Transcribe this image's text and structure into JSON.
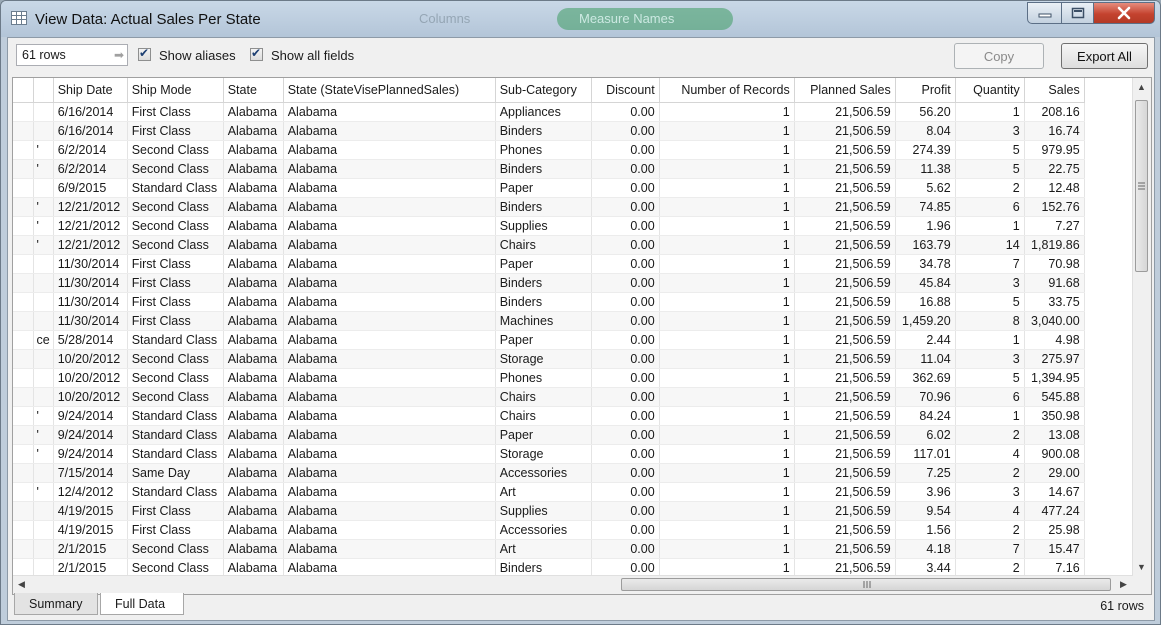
{
  "window": {
    "title": "View Data:  Actual Sales Per State",
    "ghost_columns": "Columns",
    "ghost_search": "Measure Names"
  },
  "toolbar": {
    "rows_value": "61 rows",
    "show_aliases_label": "Show aliases",
    "show_all_fields_label": "Show all fields",
    "copy_label": "Copy",
    "export_label": "Export All"
  },
  "table": {
    "columns": [
      "",
      "Ship Date",
      "Ship Mode",
      "State",
      "State (StateVisePlannedSales)",
      "Sub-Category",
      "Discount",
      "Number of Records",
      "Planned Sales",
      "Profit",
      "Quantity",
      "Sales"
    ],
    "rows": [
      [
        "",
        "6/16/2014",
        "First Class",
        "Alabama",
        "Alabama",
        "Appliances",
        "0.00",
        "1",
        "21,506.59",
        "56.20",
        "1",
        "208.16"
      ],
      [
        "",
        "6/16/2014",
        "First Class",
        "Alabama",
        "Alabama",
        "Binders",
        "0.00",
        "1",
        "21,506.59",
        "8.04",
        "3",
        "16.74"
      ],
      [
        "'",
        "6/2/2014",
        "Second Class",
        "Alabama",
        "Alabama",
        "Phones",
        "0.00",
        "1",
        "21,506.59",
        "274.39",
        "5",
        "979.95"
      ],
      [
        "'",
        "6/2/2014",
        "Second Class",
        "Alabama",
        "Alabama",
        "Binders",
        "0.00",
        "1",
        "21,506.59",
        "11.38",
        "5",
        "22.75"
      ],
      [
        "",
        "6/9/2015",
        "Standard Class",
        "Alabama",
        "Alabama",
        "Paper",
        "0.00",
        "1",
        "21,506.59",
        "5.62",
        "2",
        "12.48"
      ],
      [
        "'",
        "12/21/2012",
        "Second Class",
        "Alabama",
        "Alabama",
        "Binders",
        "0.00",
        "1",
        "21,506.59",
        "74.85",
        "6",
        "152.76"
      ],
      [
        "'",
        "12/21/2012",
        "Second Class",
        "Alabama",
        "Alabama",
        "Supplies",
        "0.00",
        "1",
        "21,506.59",
        "1.96",
        "1",
        "7.27"
      ],
      [
        "'",
        "12/21/2012",
        "Second Class",
        "Alabama",
        "Alabama",
        "Chairs",
        "0.00",
        "1",
        "21,506.59",
        "163.79",
        "14",
        "1,819.86"
      ],
      [
        "",
        "11/30/2014",
        "First Class",
        "Alabama",
        "Alabama",
        "Paper",
        "0.00",
        "1",
        "21,506.59",
        "34.78",
        "7",
        "70.98"
      ],
      [
        "",
        "11/30/2014",
        "First Class",
        "Alabama",
        "Alabama",
        "Binders",
        "0.00",
        "1",
        "21,506.59",
        "45.84",
        "3",
        "91.68"
      ],
      [
        "",
        "11/30/2014",
        "First Class",
        "Alabama",
        "Alabama",
        "Binders",
        "0.00",
        "1",
        "21,506.59",
        "16.88",
        "5",
        "33.75"
      ],
      [
        "",
        "11/30/2014",
        "First Class",
        "Alabama",
        "Alabama",
        "Machines",
        "0.00",
        "1",
        "21,506.59",
        "1,459.20",
        "8",
        "3,040.00"
      ],
      [
        "ce",
        "5/28/2014",
        "Standard Class",
        "Alabama",
        "Alabama",
        "Paper",
        "0.00",
        "1",
        "21,506.59",
        "2.44",
        "1",
        "4.98"
      ],
      [
        "",
        "10/20/2012",
        "Second Class",
        "Alabama",
        "Alabama",
        "Storage",
        "0.00",
        "1",
        "21,506.59",
        "11.04",
        "3",
        "275.97"
      ],
      [
        "",
        "10/20/2012",
        "Second Class",
        "Alabama",
        "Alabama",
        "Phones",
        "0.00",
        "1",
        "21,506.59",
        "362.69",
        "5",
        "1,394.95"
      ],
      [
        "",
        "10/20/2012",
        "Second Class",
        "Alabama",
        "Alabama",
        "Chairs",
        "0.00",
        "1",
        "21,506.59",
        "70.96",
        "6",
        "545.88"
      ],
      [
        "'",
        "9/24/2014",
        "Standard Class",
        "Alabama",
        "Alabama",
        "Chairs",
        "0.00",
        "1",
        "21,506.59",
        "84.24",
        "1",
        "350.98"
      ],
      [
        "'",
        "9/24/2014",
        "Standard Class",
        "Alabama",
        "Alabama",
        "Paper",
        "0.00",
        "1",
        "21,506.59",
        "6.02",
        "2",
        "13.08"
      ],
      [
        "'",
        "9/24/2014",
        "Standard Class",
        "Alabama",
        "Alabama",
        "Storage",
        "0.00",
        "1",
        "21,506.59",
        "117.01",
        "4",
        "900.08"
      ],
      [
        "",
        "7/15/2014",
        "Same Day",
        "Alabama",
        "Alabama",
        "Accessories",
        "0.00",
        "1",
        "21,506.59",
        "7.25",
        "2",
        "29.00"
      ],
      [
        "'",
        "12/4/2012",
        "Standard Class",
        "Alabama",
        "Alabama",
        "Art",
        "0.00",
        "1",
        "21,506.59",
        "3.96",
        "3",
        "14.67"
      ],
      [
        "",
        "4/19/2015",
        "First Class",
        "Alabama",
        "Alabama",
        "Supplies",
        "0.00",
        "1",
        "21,506.59",
        "9.54",
        "4",
        "477.24"
      ],
      [
        "",
        "4/19/2015",
        "First Class",
        "Alabama",
        "Alabama",
        "Accessories",
        "0.00",
        "1",
        "21,506.59",
        "1.56",
        "2",
        "25.98"
      ],
      [
        "",
        "2/1/2015",
        "Second Class",
        "Alabama",
        "Alabama",
        "Art",
        "0.00",
        "1",
        "21,506.59",
        "4.18",
        "7",
        "15.47"
      ],
      [
        "",
        "2/1/2015",
        "Second Class",
        "Alabama",
        "Alabama",
        "Binders",
        "0.00",
        "1",
        "21,506.59",
        "3.44",
        "2",
        "7.16"
      ]
    ]
  },
  "tabs": [
    {
      "label": "Summary"
    },
    {
      "label": "Full Data"
    }
  ],
  "status": {
    "rows_label": "61 rows"
  },
  "colors": {
    "titlebar": "#b9cadb",
    "close_button": "#c4432f"
  }
}
